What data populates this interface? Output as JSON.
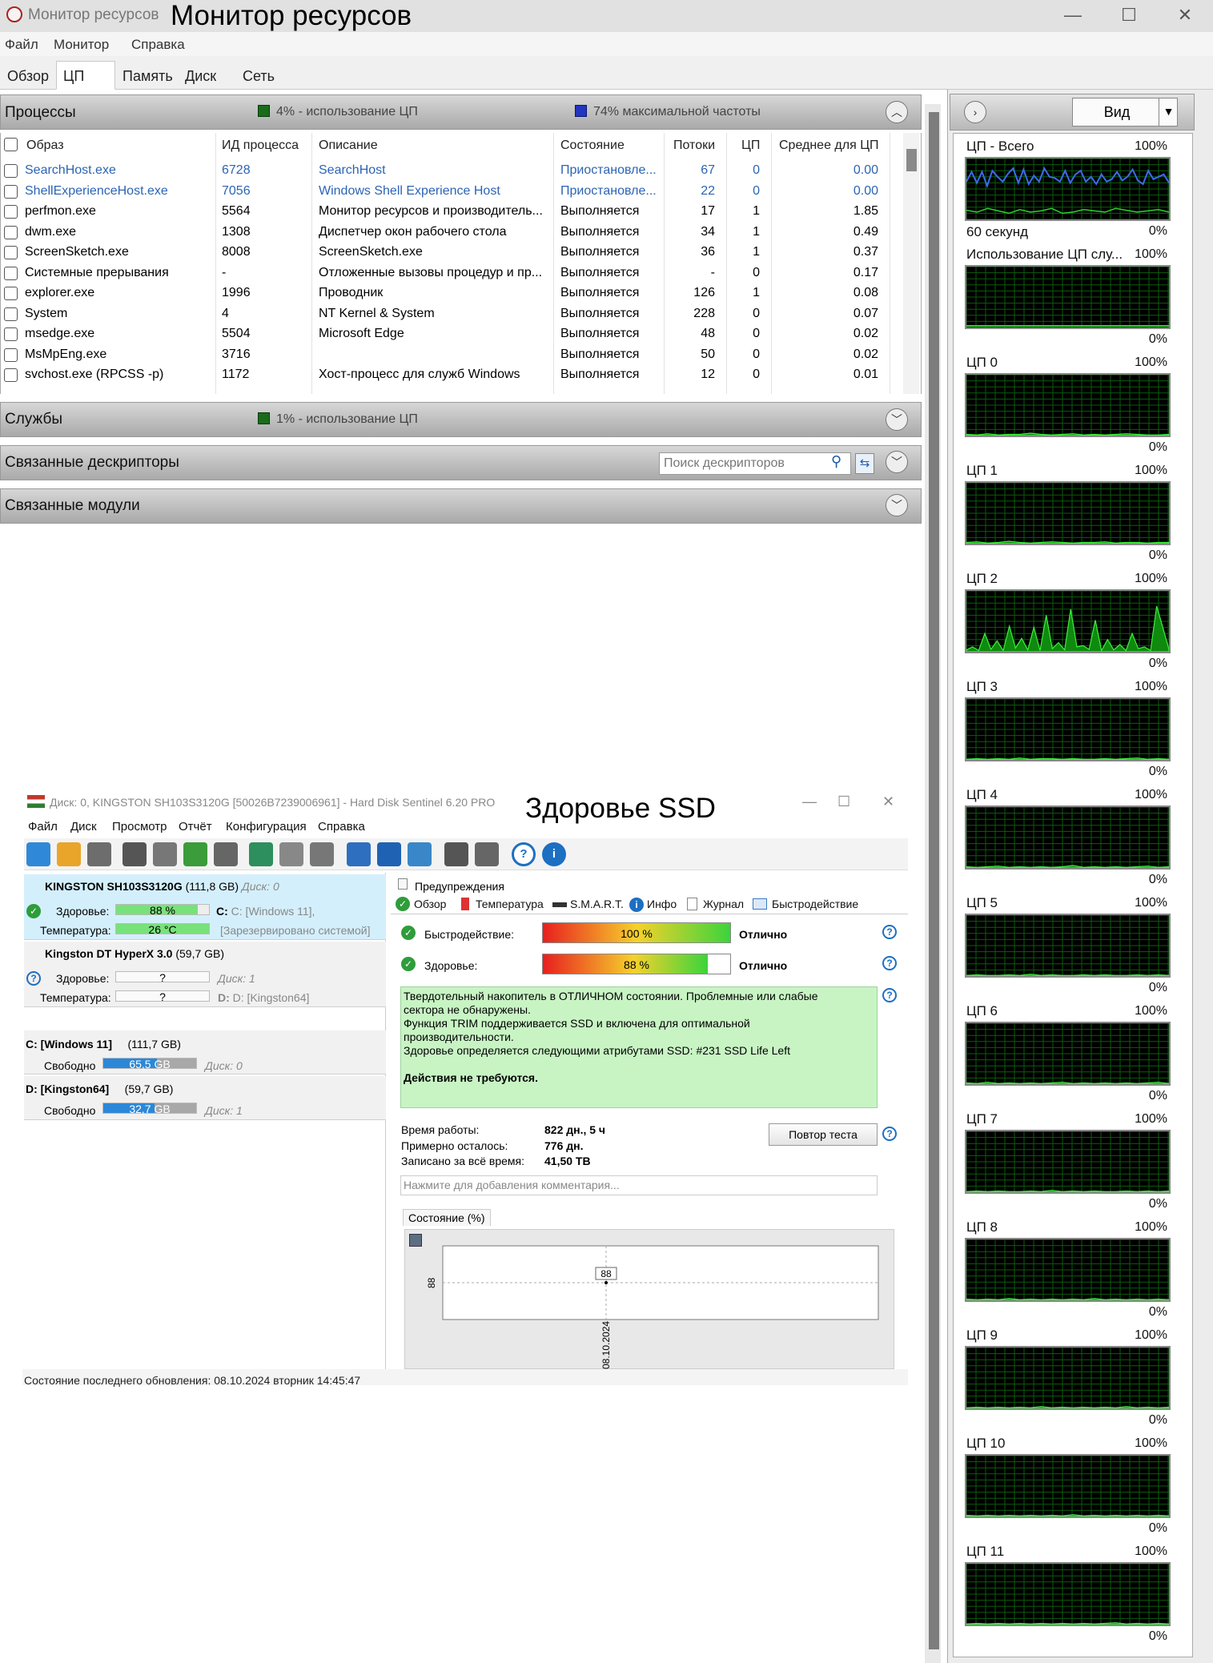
{
  "window": {
    "title": "Монитор ресурсов",
    "overlay_title": "Монитор ресурсов",
    "min": "—",
    "max": "☐",
    "close": "✕"
  },
  "menu": [
    "Файл",
    "Монитор",
    "Справка"
  ],
  "tabs": [
    "Обзор",
    "ЦП",
    "Память",
    "Диск",
    "Сеть"
  ],
  "processes": {
    "title": "Процессы",
    "cpu_usage": "4% - использование ЦП",
    "max_freq": "74% максимальной частоты",
    "columns": [
      "Образ",
      "ИД процесса",
      "Описание",
      "Состояние",
      "Потоки",
      "ЦП",
      "Среднее для ЦП"
    ],
    "rows": [
      [
        "SearchHost.exe",
        "6728",
        "SearchHost",
        "Приостановле...",
        "67",
        "0",
        "0.00"
      ],
      [
        "ShellExperienceHost.exe",
        "7056",
        "Windows Shell Experience Host",
        "Приостановле...",
        "22",
        "0",
        "0.00"
      ],
      [
        "perfmon.exe",
        "5564",
        "Монитор ресурсов и производитель...",
        "Выполняется",
        "17",
        "1",
        "1.85"
      ],
      [
        "dwm.exe",
        "1308",
        "Диспетчер окон рабочего стола",
        "Выполняется",
        "34",
        "1",
        "0.49"
      ],
      [
        "ScreenSketch.exe",
        "8008",
        "ScreenSketch.exe",
        "Выполняется",
        "36",
        "1",
        "0.37"
      ],
      [
        "Системные прерывания",
        "-",
        "Отложенные вызовы процедур и пр...",
        "Выполняется",
        "-",
        "0",
        "0.17"
      ],
      [
        "explorer.exe",
        "1996",
        "Проводник",
        "Выполняется",
        "126",
        "1",
        "0.08"
      ],
      [
        "System",
        "4",
        "NT Kernel & System",
        "Выполняется",
        "228",
        "0",
        "0.07"
      ],
      [
        "msedge.exe",
        "5504",
        "Microsoft Edge",
        "Выполняется",
        "48",
        "0",
        "0.02"
      ],
      [
        "MsMpEng.exe",
        "3716",
        "",
        "Выполняется",
        "50",
        "0",
        "0.02"
      ],
      [
        "svchost.exe (RPCSS -p)",
        "1172",
        "Хост-процесс для служб Windows",
        "Выполняется",
        "12",
        "0",
        "0.01"
      ]
    ]
  },
  "services": {
    "title": "Службы",
    "cpu_usage": "1% - использование ЦП"
  },
  "handles": {
    "title": "Связанные дескрипторы",
    "search_placeholder": "Поиск дескрипторов"
  },
  "modules": {
    "title": "Связанные модули"
  },
  "right": {
    "view_label": "Вид",
    "graphs": [
      {
        "label": "ЦП - Всего",
        "max": "100%",
        "min": "0%",
        "sub": "60 секунд",
        "color": "#3a6cf0"
      },
      {
        "label": "Использование ЦП слу...",
        "max": "100%",
        "min": "0%",
        "color": "#2ed12e"
      },
      {
        "label": "ЦП 0",
        "max": "100%",
        "min": "0%"
      },
      {
        "label": "ЦП 1",
        "max": "100%",
        "min": "0%"
      },
      {
        "label": "ЦП 2",
        "max": "100%",
        "min": "0%"
      },
      {
        "label": "ЦП 3",
        "max": "100%",
        "min": "0%"
      },
      {
        "label": "ЦП 4",
        "max": "100%",
        "min": "0%"
      },
      {
        "label": "ЦП 5",
        "max": "100%",
        "min": "0%"
      },
      {
        "label": "ЦП 6",
        "max": "100%",
        "min": "0%"
      },
      {
        "label": "ЦП 7",
        "max": "100%",
        "min": "0%"
      },
      {
        "label": "ЦП 8",
        "max": "100%",
        "min": "0%"
      },
      {
        "label": "ЦП 9",
        "max": "100%",
        "min": "0%"
      },
      {
        "label": "ЦП 10",
        "max": "100%",
        "min": "0%"
      },
      {
        "label": "ЦП 11",
        "max": "100%",
        "min": "0%"
      }
    ]
  },
  "hds": {
    "title": "Диск: 0, KINGSTON SH103S3120G [50026B7239006961]  -  Hard Disk Sentinel 6.20 PRO",
    "overlay_title": "Здоровье SSD",
    "menu": [
      "Файл",
      "Диск",
      "Просмотр",
      "Отчёт",
      "Конфигурация",
      "Справка"
    ],
    "disk1": {
      "name": "KINGSTON SH103S3120G",
      "size": "(111,8 GB)",
      "disk": "Диск: 0",
      "health_label": "Здоровье:",
      "health": "88 %",
      "health_pct": 88,
      "temp_label": "Температура:",
      "temp": "26 °C",
      "vol": "C: [Windows 11],",
      "reserved": "[Зарезервировано системой]"
    },
    "disk2": {
      "name": "Kingston DT HyperX 3.0",
      "size": "(59,7 GB)",
      "health_label": "Здоровье:",
      "health": "?",
      "temp_label": "Температура:",
      "temp": "?",
      "disk": "Диск: 1",
      "vol": "D: [Kingston64]"
    },
    "vol1": {
      "name": "C: [Windows 11]",
      "size": "(111,7 GB)",
      "free_label": "Свободно",
      "free": "65,5 GB",
      "disk": "Диск: 0"
    },
    "vol2": {
      "name": "D: [Kingston64]",
      "size": "(59,7 GB)",
      "free_label": "Свободно",
      "free": "32,7 GB",
      "disk": "Диск: 1"
    },
    "warnings": "Предупреждения",
    "tabs": [
      "Обзор",
      "Температура",
      "S.M.A.R.T.",
      "Инфо",
      "Журнал",
      "Быстродействие"
    ],
    "perf_label": "Быстродействие:",
    "perf": "100 %",
    "perf_pct": 100,
    "perf_status": "Отлично",
    "health_label": "Здоровье:",
    "health": "88 %",
    "health_pct": 88,
    "health_status": "Отлично",
    "message": [
      "Твердотельный накопитель в ОТЛИЧНОМ состоянии. Проблемные или слабые",
      "сектора не обнаружены.",
      "Функция TRIM поддерживается SSD и включена для оптимальной",
      "производительности.",
      "Здоровье определяется следующими атрибутами SSD: #231 SSD Life Left",
      "",
      "Действия не требуются."
    ],
    "uptime_label": "Время работы:",
    "uptime": "822 дн., 5 ч",
    "remain_label": "Примерно осталось:",
    "remain": "776 дн.",
    "written_label": "Записано за всё время:",
    "written": "41,50 TB",
    "retest": "Повтор теста",
    "comment_placeholder": "Нажмите для добавления комментария...",
    "chart_tab": "Состояние (%)",
    "chart_data": {
      "type": "line",
      "title": "",
      "x": [
        "08.10.2024"
      ],
      "series": [
        {
          "values": [
            88
          ]
        }
      ],
      "ylabel": "",
      "ytick": "88"
    },
    "status": "Состояние последнего обновления: 08.10.2024 вторник 14:45:47"
  }
}
